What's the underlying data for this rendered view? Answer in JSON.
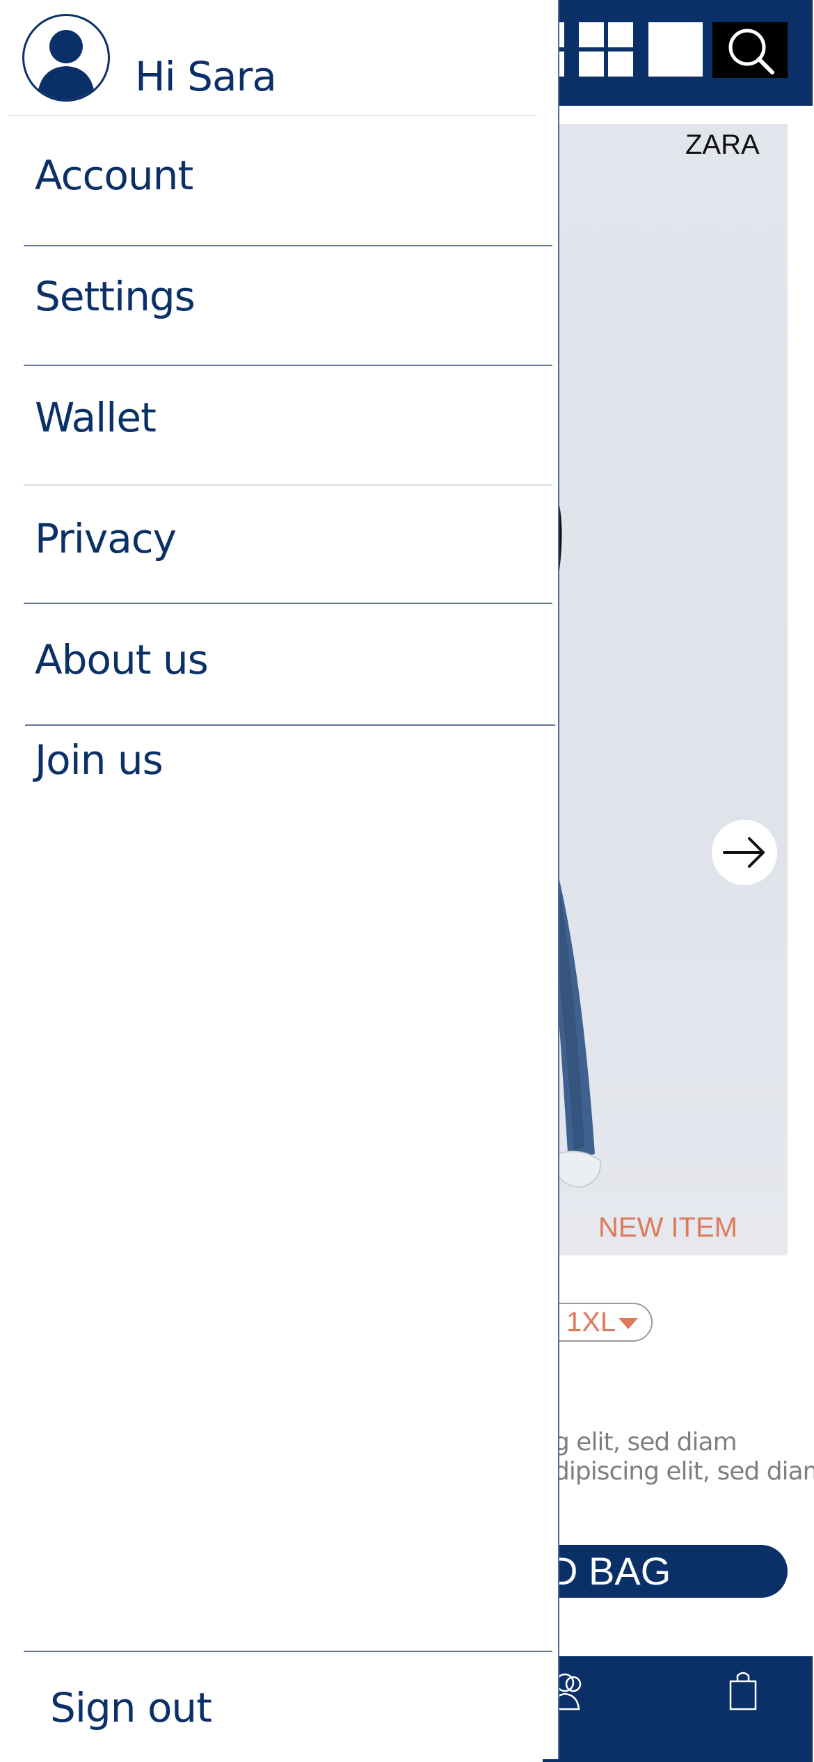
{
  "drawer": {
    "greeting": "Hi Sara",
    "menu_items": [
      {
        "label": "Account"
      },
      {
        "label": "Settings"
      },
      {
        "label": "Wallet"
      },
      {
        "label": "Privacy"
      },
      {
        "label": "About us"
      },
      {
        "label": "Join us"
      }
    ],
    "sign_out": "Sign out"
  },
  "background_page": {
    "brand": "ZARA",
    "badge": "NEW ITEM",
    "size_selector": "1XL",
    "description_lines": [
      "g elit, sed diam",
      "dipiscing elit, sed diam"
    ],
    "add_to_bag": "D BAG"
  },
  "colors": {
    "primary": "#0b3068",
    "accent": "#de7a5c",
    "background": "#ffffff"
  },
  "icons": [
    "user-avatar-icon",
    "grid-view-icon",
    "single-view-icon",
    "search-icon",
    "next-arrow-icon",
    "people-icon",
    "shopping-bag-icon",
    "dropdown-triangle-icon"
  ]
}
